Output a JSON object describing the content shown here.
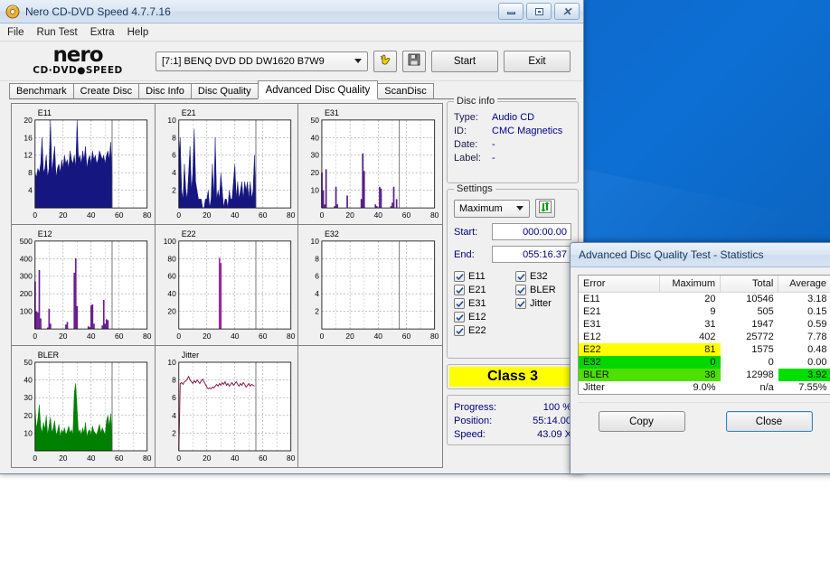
{
  "window": {
    "title": "Nero CD-DVD Speed 4.7.7.16",
    "icon": "nero-disc-icon",
    "controls": {
      "minimize": "minimize",
      "maximize": "maximize",
      "close": "close"
    }
  },
  "menu": {
    "items": [
      "File",
      "Run Test",
      "Extra",
      "Help"
    ]
  },
  "toolbar": {
    "logo_line1": "nero",
    "logo_line2": "CD·DVD",
    "logo_line3": "SPEED",
    "drive": "[7:1]  BENQ DVD DD DW1620 B7W9",
    "drive_dropdown_icon": "chevron-down-icon",
    "eject_icon": "eject-hand-icon",
    "save_icon": "floppy-save-icon",
    "start_label": "Start",
    "exit_label": "Exit"
  },
  "tabs": {
    "items": [
      "Benchmark",
      "Create Disc",
      "Disc Info",
      "Disc Quality",
      "Advanced Disc Quality",
      "ScanDisc"
    ],
    "active": "Advanced Disc Quality"
  },
  "disc_info": {
    "legend": "Disc info",
    "rows": [
      {
        "label": "Type:",
        "value": "Audio CD"
      },
      {
        "label": "ID:",
        "value": "CMC Magnetics"
      },
      {
        "label": "Date:",
        "value": "-"
      },
      {
        "label": "Label:",
        "value": "-"
      }
    ]
  },
  "settings": {
    "legend": "Settings",
    "speed": "Maximum",
    "speed_dropdown_icon": "chevron-down-icon",
    "refresh_icon": "refresh-arrows-icon",
    "start_label": "Start:",
    "start_value": "000:00.00",
    "end_label": "End:",
    "end_value": "055:16.37",
    "checkboxes": [
      {
        "label": "E11",
        "checked": true
      },
      {
        "label": "E32",
        "checked": true
      },
      {
        "label": "E21",
        "checked": true
      },
      {
        "label": "BLER",
        "checked": true
      },
      {
        "label": "E31",
        "checked": true
      },
      {
        "label": "Jitter",
        "checked": true
      },
      {
        "label": "E12",
        "checked": true
      },
      {
        "label": "",
        "checked": null
      },
      {
        "label": "E22",
        "checked": true
      },
      {
        "label": "",
        "checked": null
      }
    ]
  },
  "class_box": {
    "label": "Class 3",
    "background": "#ffff00"
  },
  "status": {
    "rows": [
      {
        "label": "Progress:",
        "value": "100 %"
      },
      {
        "label": "Position:",
        "value": "55:14.00"
      },
      {
        "label": "Speed:",
        "value": "43.09 X"
      }
    ]
  },
  "dialog": {
    "title": "Advanced Disc Quality Test - Statistics",
    "columns": [
      "Error",
      "Maximum",
      "Total",
      "Average"
    ],
    "rows": [
      {
        "error": "E11",
        "maximum": "20",
        "total": "10546",
        "average": "3.18",
        "highlight": "none"
      },
      {
        "error": "E21",
        "maximum": "9",
        "total": "505",
        "average": "0.15",
        "highlight": "none"
      },
      {
        "error": "E31",
        "maximum": "31",
        "total": "1947",
        "average": "0.59",
        "highlight": "none"
      },
      {
        "error": "E12",
        "maximum": "402",
        "total": "25772",
        "average": "7.78",
        "highlight": "none"
      },
      {
        "error": "E22",
        "maximum": "81",
        "total": "1575",
        "average": "0.48",
        "highlight": "yellow"
      },
      {
        "error": "E32",
        "maximum": "0",
        "total": "0",
        "average": "0.00",
        "highlight": "green"
      },
      {
        "error": "BLER",
        "maximum": "38",
        "total": "12998",
        "average": "3.92",
        "highlight": "green-avg"
      },
      {
        "error": "Jitter",
        "maximum": "9.0%",
        "total": "n/a",
        "average": "7.55%",
        "highlight": "none"
      }
    ],
    "copy_label": "Copy",
    "close_label": "Close",
    "highlight_colors": {
      "yellow": "#ffff00",
      "green": "#00d800",
      "bright_green": "#00e000"
    }
  },
  "chart_data": [
    {
      "type": "area",
      "title": "E11",
      "color": "#161680",
      "xlabel": "",
      "ylabel": "",
      "xlim": [
        0,
        80
      ],
      "ylim": [
        0,
        20
      ],
      "xticks": [
        0,
        20,
        40,
        60,
        80
      ],
      "yticks": [
        4,
        8,
        12,
        16,
        20
      ],
      "grid": true,
      "scan_end": 55,
      "x": [
        0,
        1,
        2,
        3,
        4,
        5,
        6,
        7,
        8,
        9,
        10,
        11,
        12,
        13,
        14,
        15,
        16,
        17,
        18,
        19,
        20,
        21,
        22,
        23,
        24,
        25,
        26,
        27,
        28,
        29,
        30,
        31,
        32,
        33,
        34,
        35,
        36,
        37,
        38,
        39,
        40,
        41,
        42,
        43,
        44,
        45,
        46,
        47,
        48,
        49,
        50,
        51,
        52,
        53,
        54,
        55
      ],
      "values": [
        8,
        7,
        9,
        8,
        10,
        16,
        8,
        9,
        12,
        7,
        9,
        20,
        8,
        11,
        14,
        7,
        9,
        10,
        8,
        11,
        9,
        12,
        10,
        11,
        9,
        13,
        11,
        10,
        12,
        9,
        20,
        11,
        12,
        10,
        13,
        11,
        14,
        9,
        11,
        12,
        10,
        13,
        11,
        12,
        10,
        11,
        13,
        12,
        11,
        12,
        10,
        12,
        13,
        11,
        15,
        8
      ]
    },
    {
      "type": "area",
      "title": "E21",
      "color": "#161680",
      "xlabel": "",
      "ylabel": "",
      "xlim": [
        0,
        80
      ],
      "ylim": [
        0,
        10
      ],
      "xticks": [
        0,
        20,
        40,
        60,
        80
      ],
      "yticks": [
        2,
        4,
        6,
        8,
        10
      ],
      "grid": true,
      "scan_end": 55,
      "x": [
        0,
        1,
        2,
        3,
        4,
        5,
        6,
        7,
        8,
        9,
        10,
        11,
        12,
        13,
        14,
        15,
        16,
        17,
        18,
        19,
        20,
        21,
        22,
        23,
        24,
        25,
        26,
        27,
        28,
        29,
        30,
        31,
        32,
        33,
        34,
        35,
        36,
        37,
        38,
        39,
        40,
        41,
        42,
        43,
        44,
        45,
        46,
        47,
        48,
        49,
        50,
        51,
        52,
        53,
        54,
        55
      ],
      "values": [
        6,
        8,
        2,
        1,
        5,
        2,
        1,
        4,
        7,
        2,
        4,
        9,
        3,
        2,
        1,
        1,
        1,
        0,
        0,
        1,
        1,
        2,
        0,
        1,
        5,
        1,
        8,
        1,
        2,
        1,
        4,
        2,
        0,
        1,
        1,
        0,
        2,
        1,
        1,
        3,
        5,
        1,
        3,
        1,
        2,
        3,
        1,
        3,
        2,
        3,
        1,
        3,
        1,
        2,
        6,
        1
      ]
    },
    {
      "type": "bar",
      "title": "E31",
      "color": "#5a1f8c",
      "xlabel": "",
      "ylabel": "",
      "xlim": [
        0,
        80
      ],
      "ylim": [
        0,
        50
      ],
      "xticks": [
        0,
        20,
        40,
        60,
        80
      ],
      "yticks": [
        10,
        20,
        30,
        40,
        50
      ],
      "grid": true,
      "scan_end": 55,
      "x": [
        0,
        1,
        2,
        3,
        4,
        5,
        6,
        7,
        8,
        9,
        10,
        11,
        12,
        13,
        14,
        15,
        16,
        17,
        18,
        19,
        20,
        21,
        22,
        23,
        24,
        25,
        26,
        27,
        28,
        29,
        30,
        31,
        32,
        33,
        34,
        35,
        36,
        37,
        38,
        39,
        40,
        41,
        42,
        43,
        44,
        45,
        46,
        47,
        48,
        49,
        50,
        51,
        52,
        53,
        54
      ],
      "values": [
        20,
        10,
        2,
        22,
        0,
        0,
        0,
        0,
        0,
        1,
        12,
        2,
        0,
        0,
        0,
        0,
        0,
        0,
        7,
        0,
        0,
        0,
        0,
        0,
        0,
        0,
        0,
        0,
        5,
        31,
        21,
        0,
        0,
        0,
        0,
        0,
        0,
        0,
        2,
        1,
        0,
        12,
        11,
        0,
        0,
        0,
        0,
        0,
        0,
        1,
        3,
        12,
        0,
        5,
        0
      ]
    },
    {
      "type": "bar",
      "title": "E12",
      "color": "#6a1f8f",
      "xlabel": "",
      "ylabel": "",
      "xlim": [
        0,
        80
      ],
      "ylim": [
        0,
        500
      ],
      "xticks": [
        0,
        20,
        40,
        60,
        80
      ],
      "yticks": [
        100,
        200,
        300,
        400,
        500
      ],
      "grid": true,
      "scan_end": 55,
      "x": [
        0,
        1,
        2,
        3,
        4,
        5,
        6,
        7,
        8,
        9,
        10,
        11,
        12,
        13,
        14,
        15,
        16,
        17,
        18,
        19,
        20,
        21,
        22,
        23,
        24,
        25,
        26,
        27,
        28,
        29,
        30,
        31,
        32,
        33,
        34,
        35,
        36,
        37,
        38,
        39,
        40,
        41,
        42,
        43,
        44,
        45,
        46,
        47,
        48,
        49,
        50,
        51,
        52,
        53,
        54
      ],
      "values": [
        270,
        100,
        95,
        335,
        60,
        0,
        0,
        0,
        0,
        8,
        115,
        30,
        0,
        0,
        0,
        0,
        0,
        0,
        0,
        0,
        0,
        0,
        25,
        40,
        0,
        0,
        0,
        0,
        320,
        402,
        130,
        0,
        0,
        0,
        0,
        0,
        0,
        0,
        15,
        10,
        135,
        140,
        30,
        0,
        0,
        0,
        0,
        0,
        20,
        165,
        30,
        55,
        50,
        0,
        0
      ]
    },
    {
      "type": "bar",
      "title": "E22",
      "color": "#9c2a9c",
      "xlabel": "",
      "ylabel": "",
      "xlim": [
        0,
        80
      ],
      "ylim": [
        0,
        100
      ],
      "xticks": [
        0,
        20,
        40,
        60,
        80
      ],
      "yticks": [
        20,
        40,
        60,
        80,
        100
      ],
      "grid": true,
      "scan_end": 55,
      "x": [
        0,
        10,
        20,
        29,
        30,
        40,
        50,
        54
      ],
      "values": [
        0,
        0,
        0,
        81,
        75,
        0,
        0,
        0
      ]
    },
    {
      "type": "bar",
      "title": "E32",
      "color": "#9c2a9c",
      "xlabel": "",
      "ylabel": "",
      "xlim": [
        0,
        80
      ],
      "ylim": [
        0,
        10
      ],
      "xticks": [
        0,
        20,
        40,
        60,
        80
      ],
      "yticks": [
        2,
        4,
        6,
        8,
        10
      ],
      "grid": true,
      "scan_end": 55,
      "x": [],
      "values": []
    },
    {
      "type": "area",
      "title": "BLER",
      "color": "#008000",
      "xlabel": "",
      "ylabel": "",
      "xlim": [
        0,
        80
      ],
      "ylim": [
        0,
        50
      ],
      "xticks": [
        0,
        20,
        40,
        60,
        80
      ],
      "yticks": [
        10,
        20,
        30,
        40,
        50
      ],
      "grid": true,
      "scan_end": 55,
      "x": [
        0,
        1,
        2,
        3,
        4,
        5,
        6,
        7,
        8,
        9,
        10,
        11,
        12,
        13,
        14,
        15,
        16,
        17,
        18,
        19,
        20,
        21,
        22,
        23,
        24,
        25,
        26,
        27,
        28,
        29,
        30,
        31,
        32,
        33,
        34,
        35,
        36,
        37,
        38,
        39,
        40,
        41,
        42,
        43,
        44,
        45,
        46,
        47,
        48,
        49,
        50,
        51,
        52,
        53,
        54,
        55
      ],
      "values": [
        24,
        12,
        18,
        26,
        14,
        10,
        16,
        12,
        20,
        9,
        14,
        19,
        10,
        13,
        17,
        9,
        11,
        15,
        8,
        12,
        10,
        13,
        9,
        11,
        14,
        10,
        12,
        9,
        33,
        38,
        24,
        10,
        12,
        9,
        13,
        10,
        16,
        8,
        11,
        12,
        9,
        14,
        11,
        10,
        9,
        12,
        15,
        10,
        13,
        11,
        9,
        17,
        20,
        14,
        21,
        8
      ]
    },
    {
      "type": "line",
      "title": "Jitter",
      "color": "#8b1a4a",
      "xlabel": "",
      "ylabel": "",
      "xlim": [
        0,
        80
      ],
      "ylim": [
        0,
        10
      ],
      "xticks": [
        0,
        20,
        40,
        60,
        80
      ],
      "yticks": [
        2,
        4,
        6,
        8,
        10
      ],
      "grid": true,
      "scan_end": 55,
      "x": [
        0,
        1,
        2,
        3,
        4,
        5,
        6,
        7,
        8,
        9,
        10,
        11,
        12,
        13,
        14,
        15,
        16,
        17,
        18,
        19,
        20,
        21,
        22,
        23,
        24,
        25,
        26,
        27,
        28,
        29,
        30,
        31,
        32,
        33,
        34,
        35,
        36,
        37,
        38,
        39,
        40,
        41,
        42,
        43,
        44,
        45,
        46,
        47,
        48,
        49,
        50,
        51,
        52,
        53,
        54
      ],
      "values": [
        0,
        7.6,
        7.7,
        7.5,
        7.8,
        7.9,
        8.1,
        8.4,
        8.0,
        7.8,
        7.6,
        7.9,
        7.7,
        8.0,
        7.8,
        7.6,
        7.9,
        8.1,
        7.8,
        7.5,
        7.2,
        7.0,
        7.1,
        7.0,
        7.2,
        7.1,
        7.3,
        7.5,
        7.3,
        7.6,
        7.4,
        7.7,
        7.5,
        7.8,
        7.4,
        7.6,
        7.3,
        7.5,
        7.7,
        7.4,
        7.6,
        7.8,
        7.5,
        7.3,
        7.6,
        7.4,
        7.7,
        7.5,
        7.2,
        7.4,
        7.6,
        7.3,
        7.5,
        7.4,
        7.3
      ]
    }
  ]
}
